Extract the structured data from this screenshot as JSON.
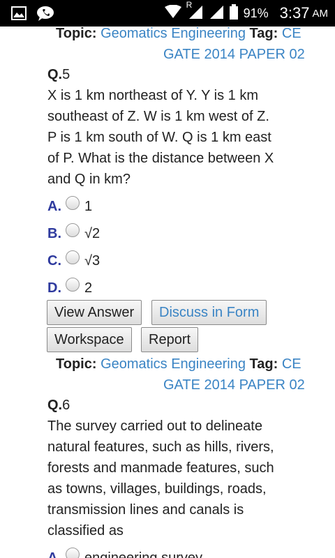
{
  "status_bar": {
    "signal_label": "R",
    "battery": "91%",
    "time": "3:37",
    "ampm": "AM"
  },
  "q5": {
    "topic_label": "Topic:",
    "topic_value": "Geomatics Engineering",
    "tag_label": "Tag:",
    "tag_value": "CE",
    "paper": "GATE 2014 PAPER 02",
    "number_prefix": "Q.",
    "number": "5",
    "text_lines": [
      "X is 1 km northeast of Y. Y is 1 km",
      "southeast of Z. W is 1 km west of Z.",
      "P is 1 km south of W. Q is 1 km east",
      "of P. What is the distance between X",
      "and Q in km?"
    ],
    "options": [
      {
        "letter": "A.",
        "text": "1"
      },
      {
        "letter": "B.",
        "text": "√2"
      },
      {
        "letter": "C.",
        "text": "√3"
      },
      {
        "letter": "D.",
        "text": "2"
      }
    ],
    "buttons": {
      "view_answer": "View Answer",
      "discuss": "Discuss in Form",
      "workspace": "Workspace",
      "report": "Report"
    }
  },
  "q6": {
    "topic_label": "Topic:",
    "topic_value": "Geomatics Engineering",
    "tag_label": "Tag:",
    "tag_value": "CE",
    "paper": "GATE 2014 PAPER 02",
    "number_prefix": "Q.",
    "number": "6",
    "text_lines": [
      "The survey carried out to delineate",
      "natural features, such as hills, rivers,",
      "forests and manmade features, such",
      "as towns, villages, buildings, roads,",
      "transmission lines and canals is",
      "classified as"
    ],
    "options": [
      {
        "letter": "A.",
        "text": "engineering survey"
      }
    ]
  }
}
